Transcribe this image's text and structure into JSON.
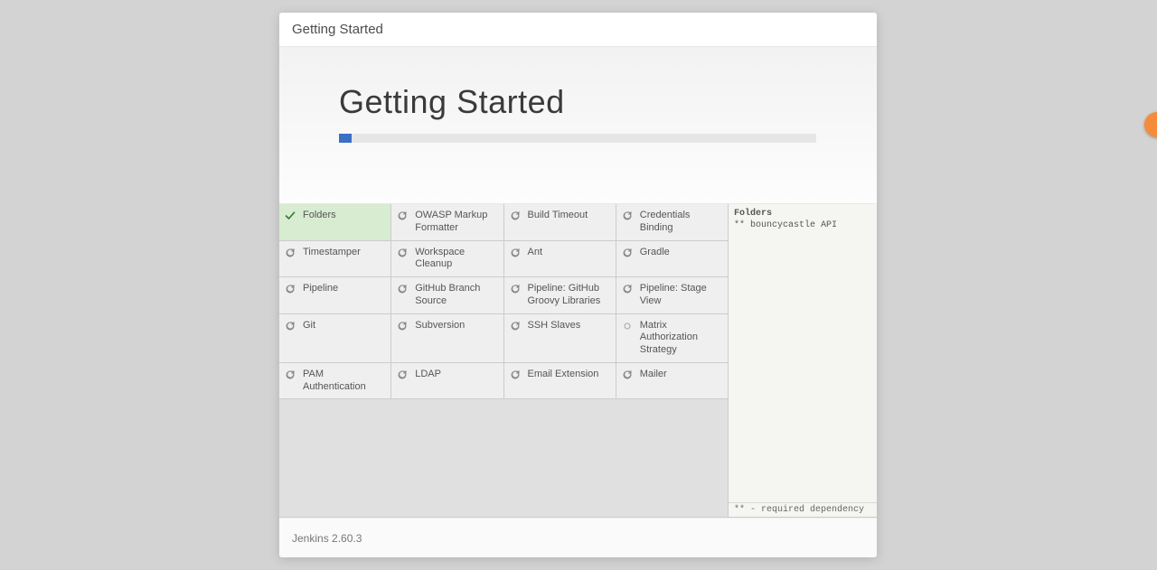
{
  "modal_title": "Getting Started",
  "hero_title": "Getting Started",
  "progress_percent": 3,
  "plugins": [
    [
      {
        "name": "Folders",
        "status": "done"
      },
      {
        "name": "OWASP Markup Formatter",
        "status": "pending"
      },
      {
        "name": "Build Timeout",
        "status": "pending"
      },
      {
        "name": "Credentials Binding",
        "status": "pending"
      }
    ],
    [
      {
        "name": "Timestamper",
        "status": "pending"
      },
      {
        "name": "Workspace Cleanup",
        "status": "pending"
      },
      {
        "name": "Ant",
        "status": "pending"
      },
      {
        "name": "Gradle",
        "status": "pending"
      }
    ],
    [
      {
        "name": "Pipeline",
        "status": "pending"
      },
      {
        "name": "GitHub Branch Source",
        "status": "pending"
      },
      {
        "name": "Pipeline: GitHub Groovy Libraries",
        "status": "pending"
      },
      {
        "name": "Pipeline: Stage View",
        "status": "pending"
      }
    ],
    [
      {
        "name": "Git",
        "status": "pending"
      },
      {
        "name": "Subversion",
        "status": "pending"
      },
      {
        "name": "SSH Slaves",
        "status": "pending"
      },
      {
        "name": "Matrix Authorization Strategy",
        "status": "waiting"
      }
    ],
    [
      {
        "name": "PAM Authentication",
        "status": "pending"
      },
      {
        "name": "LDAP",
        "status": "pending"
      },
      {
        "name": "Email Extension",
        "status": "pending"
      },
      {
        "name": "Mailer",
        "status": "pending"
      }
    ]
  ],
  "log": {
    "entries": [
      "Folders",
      "** bouncycastle API"
    ],
    "footer": "** - required dependency"
  },
  "footer_version": "Jenkins 2.60.3"
}
